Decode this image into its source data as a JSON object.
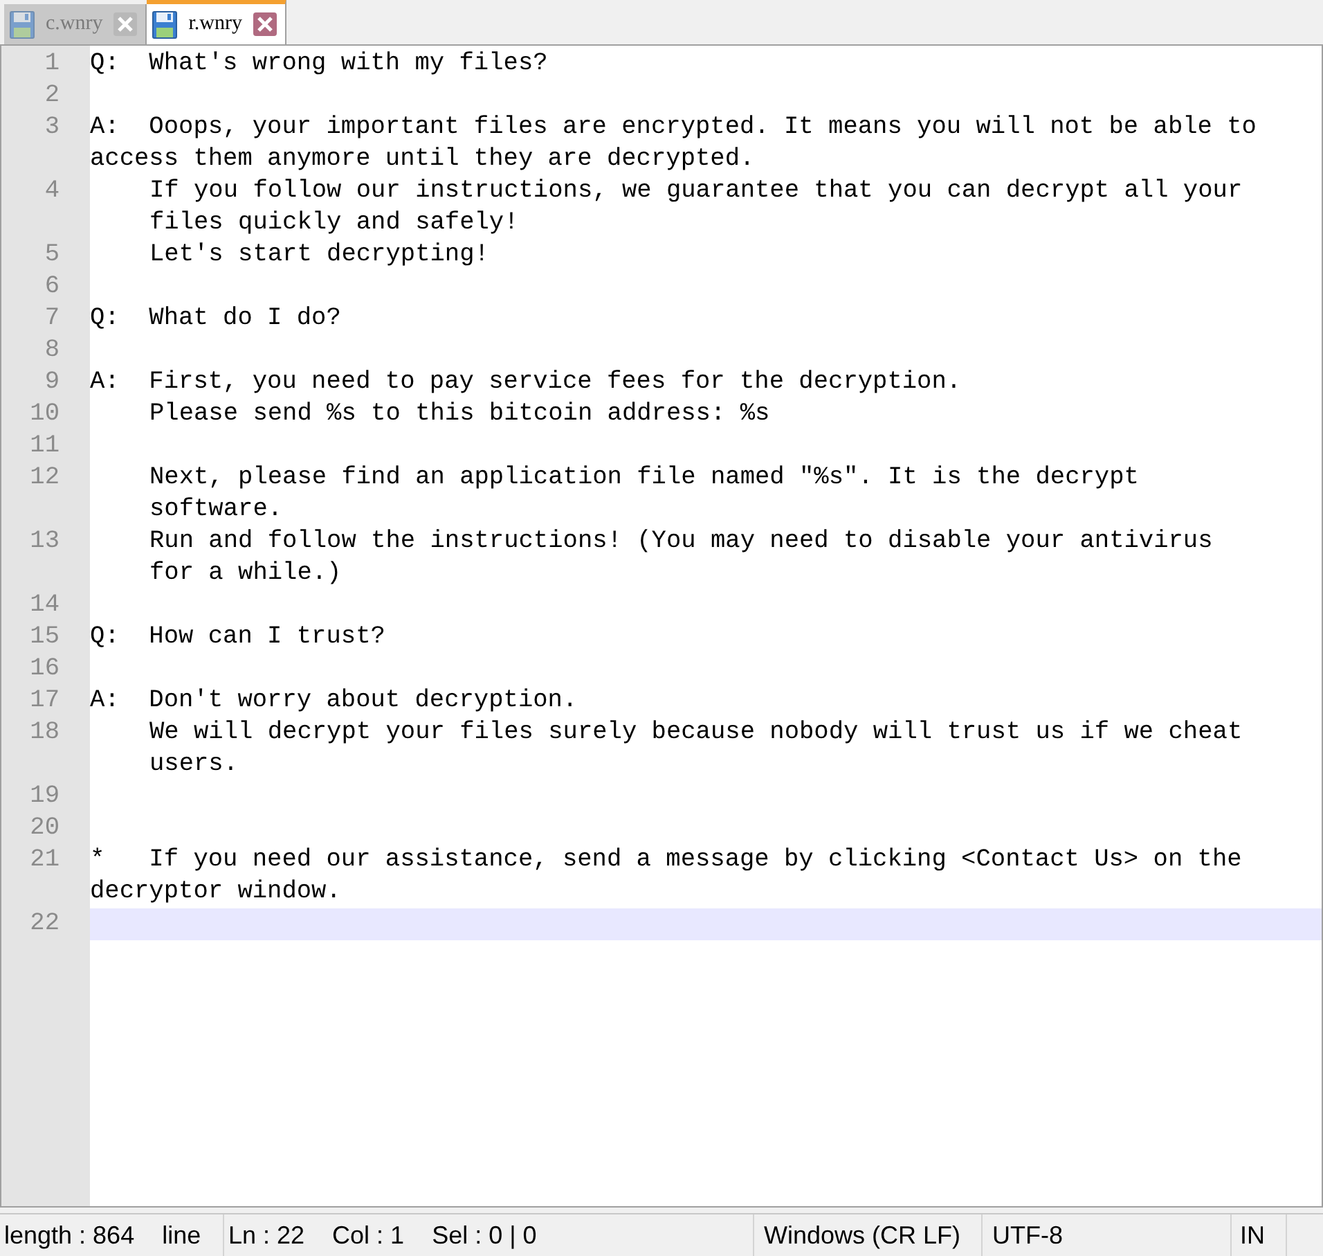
{
  "tabs": [
    {
      "label": "c.wnry",
      "selected": false
    },
    {
      "label": "r.wnry",
      "selected": true
    }
  ],
  "editor": {
    "lines": [
      {
        "number": "1",
        "text": "Q:  What's wrong with my files?",
        "indent": false,
        "current": false
      },
      {
        "number": "2",
        "current": false
      },
      {
        "number": "3",
        "text": "A:  Ooops, your important files are encrypted. It means you will not be able to access them anymore until they are decrypted.",
        "indent": false,
        "current": false
      },
      {
        "number": "4",
        "text": "If you follow our instructions, we guarantee that you can decrypt all your files quickly and safely!",
        "indent": true,
        "current": false
      },
      {
        "number": "5",
        "text": "Let's start decrypting!",
        "indent": true,
        "current": false
      },
      {
        "number": "6",
        "current": false
      },
      {
        "number": "7",
        "text": "Q:  What do I do?",
        "indent": false,
        "current": false
      },
      {
        "number": "8",
        "current": false
      },
      {
        "number": "9",
        "text": "A:  First, you need to pay service fees for the decryption.",
        "indent": false,
        "current": false
      },
      {
        "number": "10",
        "text": "Please send %s to this bitcoin address: %s",
        "indent": true,
        "current": false
      },
      {
        "number": "11",
        "current": false
      },
      {
        "number": "12",
        "text": "Next, please find an application file named \"%s\". It is the decrypt software.",
        "indent": true,
        "current": false
      },
      {
        "number": "13",
        "text": "Run and follow the instructions! (You may need to disable your antivirus for a while.)",
        "indent": true,
        "current": false
      },
      {
        "number": "14",
        "current": false
      },
      {
        "number": "15",
        "text": "Q:  How can I trust?",
        "indent": false,
        "current": false
      },
      {
        "number": "16",
        "current": false
      },
      {
        "number": "17",
        "text": "A:  Don't worry about decryption.",
        "indent": false,
        "current": false
      },
      {
        "number": "18",
        "text": "We will decrypt your files surely because nobody will trust us if we cheat users.",
        "indent": true,
        "current": false
      },
      {
        "number": "19",
        "current": false
      },
      {
        "number": "20",
        "current": false
      },
      {
        "number": "21",
        "text": "*   If you need our assistance, send a message by clicking <Contact Us> on the decryptor window.",
        "indent": false,
        "current": false
      },
      {
        "number": "22",
        "current": true
      }
    ]
  },
  "status_bar": {
    "length": "length : 864",
    "lines": "line",
    "position": "Ln : 22",
    "column": "Col : 1",
    "selection": "Sel : 0 | 0",
    "eol": "Windows (CR LF)",
    "encoding": "UTF-8",
    "mode": "IN"
  }
}
